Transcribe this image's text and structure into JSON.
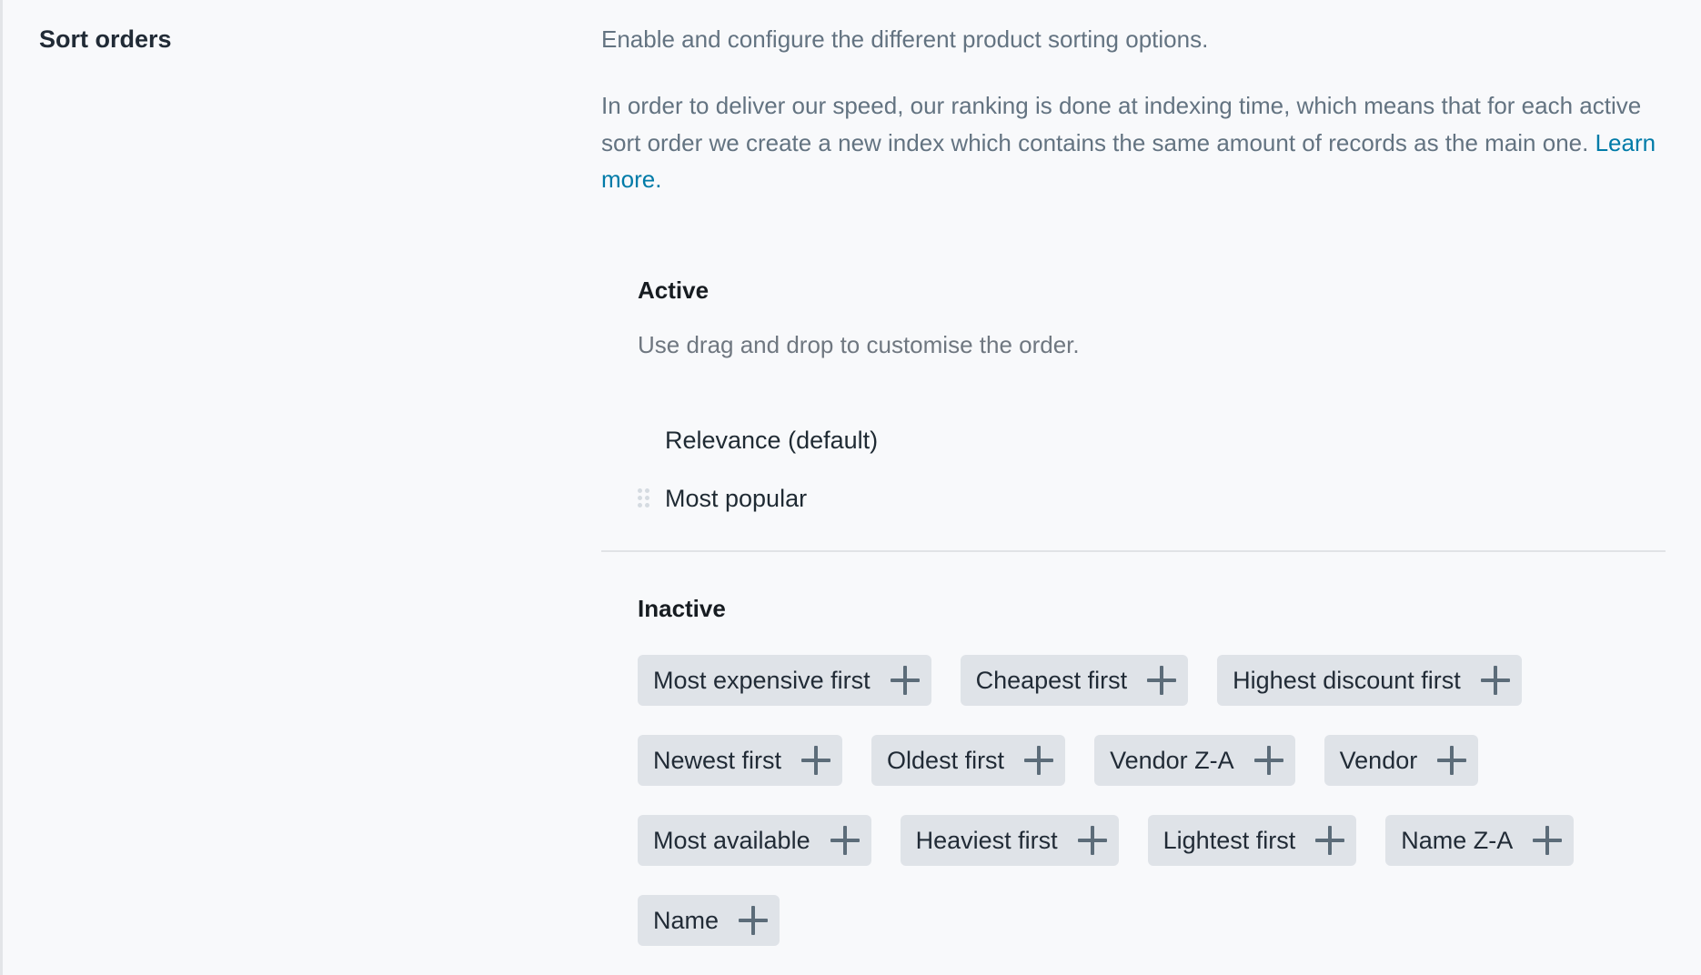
{
  "section": {
    "title": "Sort orders",
    "description": "Enable and configure the different product sorting options.",
    "explanation": "In order to deliver our speed, our ranking is done at indexing time, which means that for each active sort order we create a new index which contains the same amount of records as the main one.",
    "learn_more_label": "Learn more."
  },
  "active": {
    "heading": "Active",
    "hint": "Use drag and drop to customise the order.",
    "items": [
      {
        "label": "Relevance (default)",
        "draggable": false
      },
      {
        "label": "Most popular",
        "draggable": true,
        "icon": "drag-handle-icon"
      }
    ]
  },
  "inactive": {
    "heading": "Inactive",
    "add_icon": "plus-icon",
    "items": [
      {
        "label": "Most expensive first"
      },
      {
        "label": "Cheapest first"
      },
      {
        "label": "Highest discount first"
      },
      {
        "label": "Newest first"
      },
      {
        "label": "Oldest first"
      },
      {
        "label": "Vendor Z-A"
      },
      {
        "label": "Vendor"
      },
      {
        "label": "Most available"
      },
      {
        "label": "Heaviest first"
      },
      {
        "label": "Lightest first"
      },
      {
        "label": "Name Z-A"
      },
      {
        "label": "Name"
      }
    ]
  },
  "colors": {
    "background": "#f8f9fb",
    "link": "#007ba8",
    "chip_background": "#dfe3e8",
    "icon": "#5c6c79",
    "muted_text": "#637381"
  }
}
